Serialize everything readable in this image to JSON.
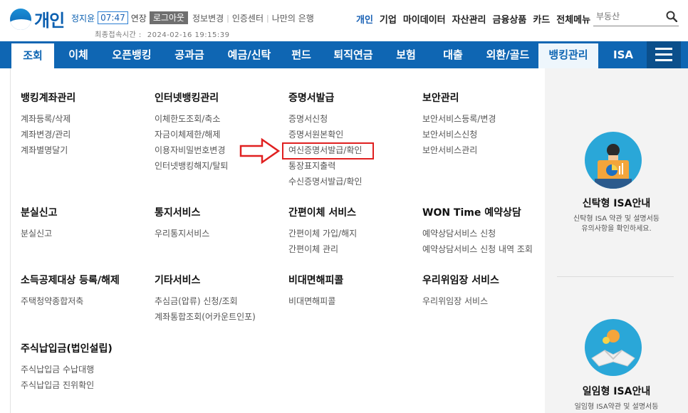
{
  "header": {
    "logo_text": "개인",
    "user_name": "정지윤",
    "timer": "07:47",
    "extend": "연장",
    "logout": "로그아웃",
    "util_links": [
      "정보변경",
      "인증센터",
      "나만의 은행"
    ],
    "last_login_label": "최종접속시간 :",
    "last_login_value": "2024-02-16 19:15:39",
    "top_nav": [
      "개인",
      "기업",
      "마이데이터",
      "자산관리",
      "금융상품",
      "카드",
      "전체메뉴"
    ],
    "search_placeholder": "부동산"
  },
  "navbar": {
    "items": [
      "조회",
      "이체",
      "오픈뱅킹",
      "공과금",
      "예금/신탁",
      "펀드",
      "퇴직연금",
      "보험",
      "대출",
      "외환/골드",
      "뱅킹관리",
      "ISA"
    ]
  },
  "menu": {
    "sections": [
      {
        "title": "뱅킹계좌관리",
        "links": [
          "계좌등록/삭제",
          "계좌변경/관리",
          "계좌별명달기"
        ]
      },
      {
        "title": "인터넷뱅킹관리",
        "links": [
          "이체한도조회/축소",
          "자금이체제한/해제",
          "이용자비밀번호변경",
          "인터넷뱅킹해지/탈퇴"
        ]
      },
      {
        "title": "증명서발급",
        "links": [
          "증명서신청",
          "증명서원본확인",
          "여신증명서발급/확인",
          "통장표지출력",
          "수신증명서발급/확인"
        ]
      },
      {
        "title": "보안관리",
        "links": [
          "보안서비스등록/변경",
          "보안서비스신청",
          "보안서비스관리"
        ]
      },
      {
        "title": "분실신고",
        "links": [
          "분실신고"
        ]
      },
      {
        "title": "통지서비스",
        "links": [
          "우리통지서비스"
        ]
      },
      {
        "title": "간편이체 서비스",
        "links": [
          "간편이체 가입/해지",
          "간편이체 관리"
        ]
      },
      {
        "title": "WON Time 예약상담",
        "links": [
          "예약상담서비스 신청",
          "예약상담서비스 신청 내역 조회"
        ]
      },
      {
        "title": "소득공제대상 등록/해제",
        "links": [
          "주택청약종합저축"
        ]
      },
      {
        "title": "기타서비스",
        "links": [
          "추심금(압류) 신청/조회",
          "계좌통합조회(어카운트인포)"
        ]
      },
      {
        "title": "비대면해피콜",
        "links": [
          "비대면해피콜"
        ]
      },
      {
        "title": "우리위임장 서비스",
        "links": [
          "우리위임장 서비스"
        ]
      },
      {
        "title": "주식납입금(법인설립)",
        "links": [
          "주식납입금 수납대행",
          "주식납입금 진위확인"
        ]
      }
    ]
  },
  "panel": {
    "promo1_title": "신탁형 ISA안내",
    "promo1_desc1": "신탁형 ISA 약관 및 설명서등",
    "promo1_desc2": "유의사항을 확인하세요.",
    "promo2_title": "일임형 ISA안내",
    "promo2_desc1": "일임형 ISA약관 및 설명서등"
  },
  "colors": {
    "brand_blue": "#0f66b3",
    "highlight_red": "#e02020"
  }
}
